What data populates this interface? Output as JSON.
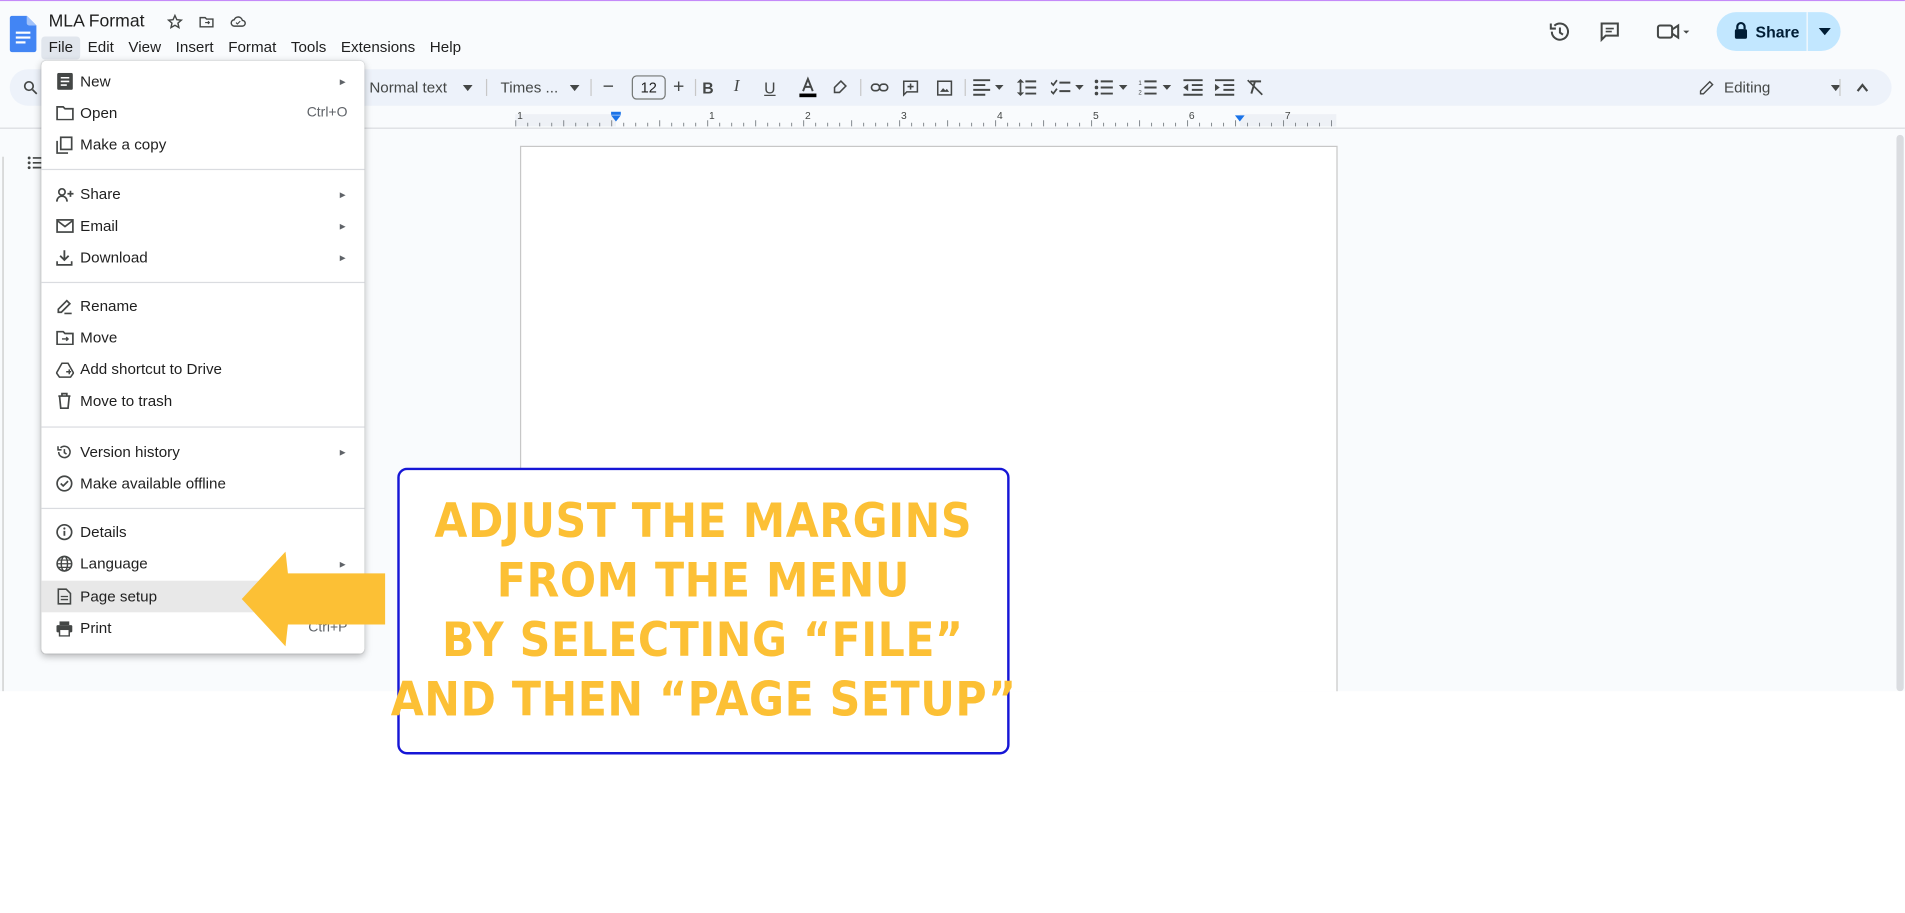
{
  "doc": {
    "title": "MLA Format"
  },
  "menubar": [
    "File",
    "Edit",
    "View",
    "Insert",
    "Format",
    "Tools",
    "Extensions",
    "Help"
  ],
  "header": {
    "share_label": "Share"
  },
  "toolbar": {
    "style": "Normal text",
    "font": "Times ...",
    "font_size": "12",
    "mode": "Editing"
  },
  "ruler": [
    "1",
    "1",
    "2",
    "3",
    "4",
    "5",
    "6",
    "7"
  ],
  "file_menu": {
    "items": [
      {
        "label": "New",
        "icon": "doc-icon",
        "submenu": true
      },
      {
        "label": "Open",
        "icon": "folder-icon",
        "shortcut": "Ctrl+O"
      },
      {
        "label": "Make a copy",
        "icon": "copy-icon"
      },
      {
        "label": "Share",
        "icon": "person-add-icon",
        "submenu": true
      },
      {
        "label": "Email",
        "icon": "mail-icon",
        "submenu": true
      },
      {
        "label": "Download",
        "icon": "download-icon",
        "submenu": true
      },
      {
        "label": "Rename",
        "icon": "rename-icon"
      },
      {
        "label": "Move",
        "icon": "move-folder-icon"
      },
      {
        "label": "Add shortcut to Drive",
        "icon": "drive-shortcut-icon"
      },
      {
        "label": "Move to trash",
        "icon": "trash-icon"
      },
      {
        "label": "Version history",
        "icon": "history-icon",
        "submenu": true
      },
      {
        "label": "Make available offline",
        "icon": "offline-icon"
      },
      {
        "label": "Details",
        "icon": "info-icon"
      },
      {
        "label": "Language",
        "icon": "globe-icon",
        "submenu": true
      },
      {
        "label": "Page setup",
        "icon": "page-icon",
        "highlighted": true
      },
      {
        "label": "Print",
        "icon": "print-icon",
        "shortcut": "Ctrl+P"
      }
    ]
  },
  "callout": {
    "lines": [
      "Adjust the margins",
      "from the menu",
      "by selecting “File”",
      "and then “Page setup”"
    ],
    "text_color": "#fcc035",
    "border_color": "#1616d6"
  },
  "colors": {
    "accent": "#0b57d0",
    "share_bg": "#c2e7ff",
    "toolbar_bg": "#edf2fa"
  }
}
